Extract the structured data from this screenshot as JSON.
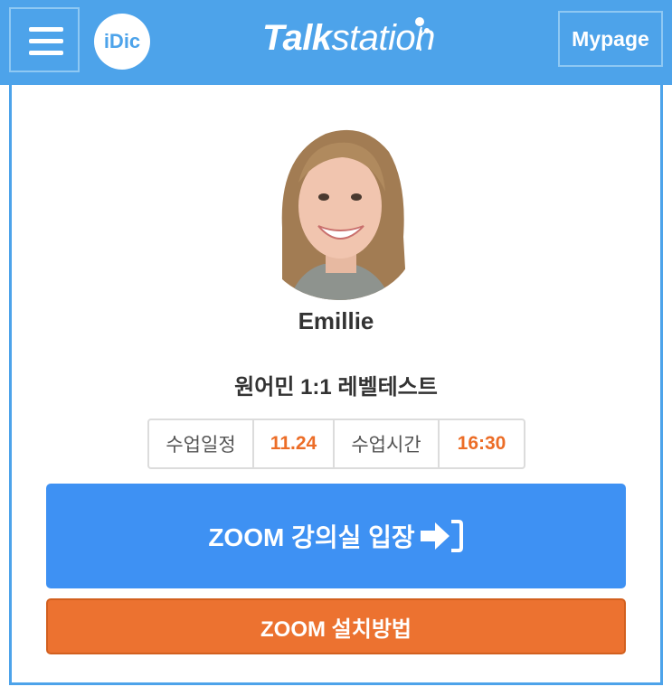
{
  "header": {
    "idic_label": "iDic",
    "logo_strong": "Talk",
    "logo_light": "station",
    "mypage_label": "Mypage",
    "accent_color": "#4da3ea"
  },
  "teacher": {
    "name": "Emillie"
  },
  "lesson": {
    "title": "원어민 1:1 레벨테스트",
    "schedule_label": "수업일정",
    "schedule_value": "11.24",
    "time_label": "수업시간",
    "time_value": "16:30"
  },
  "actions": {
    "enter_label": "ZOOM 강의실 입장",
    "enter_icon": "enter-arrow-icon",
    "install_label": "ZOOM 설치방법",
    "enter_color": "#3e91f3",
    "install_color": "#ec7230"
  }
}
